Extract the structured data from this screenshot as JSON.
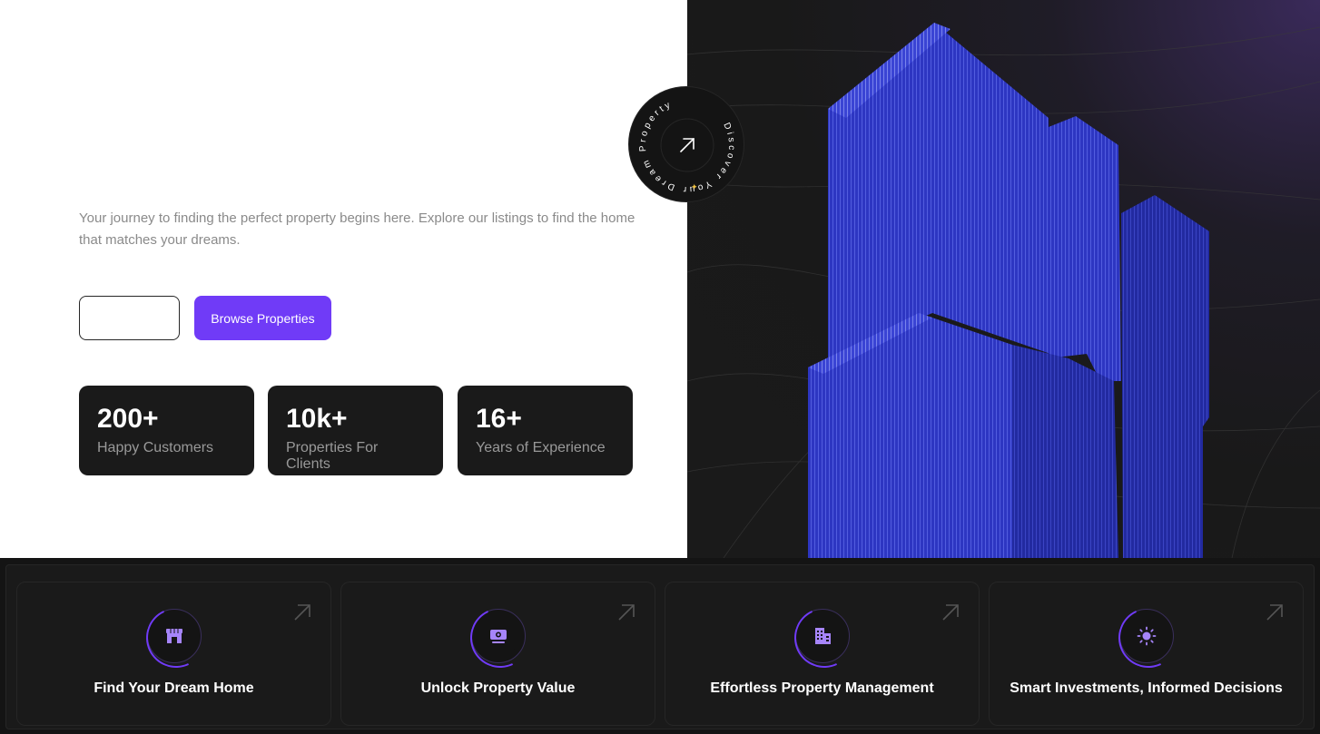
{
  "hero": {
    "intro": "Your journey to finding the perfect property begins here. Explore our listings to find the home that matches your dreams.",
    "learn_more_label": "",
    "browse_label": "Browse Properties"
  },
  "badge": {
    "ring_text": "Discover Your Dream Property",
    "icon": "arrow-up-right-icon"
  },
  "stats": [
    {
      "value": "200+",
      "label": "Happy Customers"
    },
    {
      "value": "10k+",
      "label": "Properties For Clients"
    },
    {
      "value": "16+",
      "label": "Years of Experience"
    }
  ],
  "features": [
    {
      "title": "Find Your Dream Home",
      "icon": "storefront-icon"
    },
    {
      "title": "Unlock Property Value",
      "icon": "cash-icon"
    },
    {
      "title": "Effortless Property Management",
      "icon": "buildings-icon"
    },
    {
      "title": "Smart Investments, Informed Decisions",
      "icon": "sun-icon"
    }
  ],
  "colors": {
    "accent": "#703bf7",
    "dark": "#1a1a1a",
    "border": "#262626",
    "building": "#2b33b8"
  }
}
